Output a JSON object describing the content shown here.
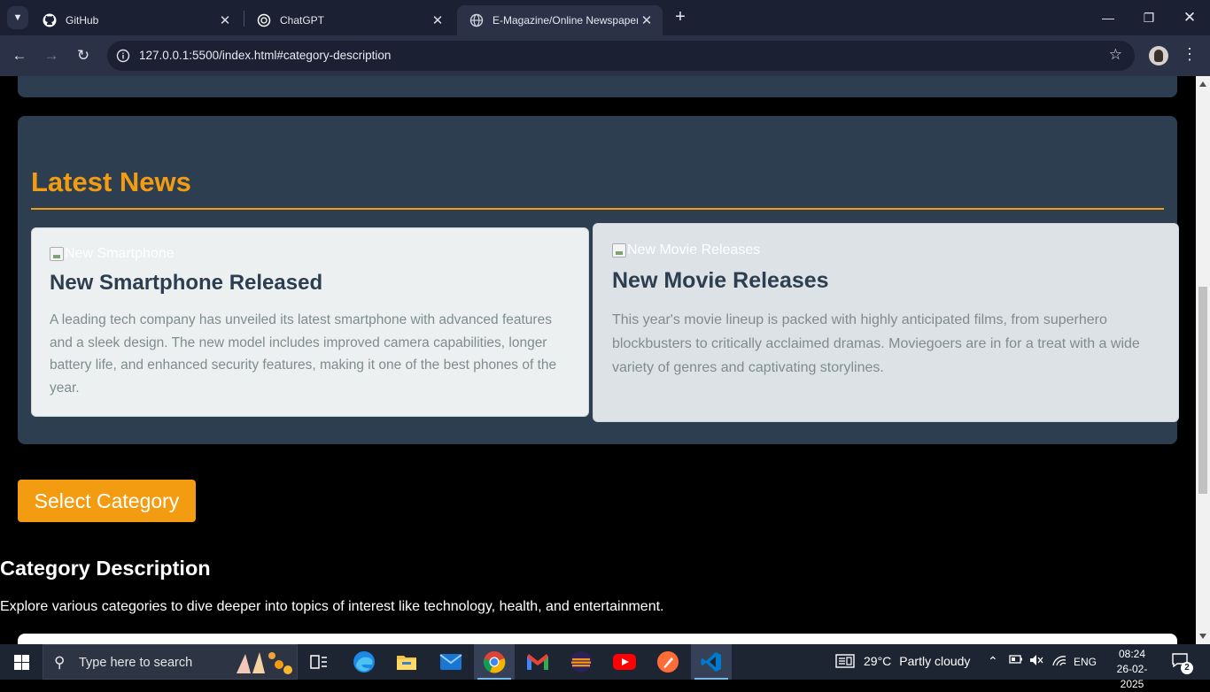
{
  "browser": {
    "tabs": [
      {
        "title": "GitHub",
        "icon": "github-icon"
      },
      {
        "title": "ChatGPT",
        "icon": "chatgpt-icon"
      },
      {
        "title": "E-Magazine/Online Newspaper",
        "icon": "globe-icon",
        "active": true
      }
    ],
    "new_tab_label": "+",
    "url": "127.0.0.1:5500/index.html#category-description"
  },
  "page": {
    "latest_news": {
      "title": "Latest News",
      "articles": [
        {
          "image_alt": "New Smartphone",
          "title": "New Smartphone Released",
          "body": "A leading tech company has unveiled its latest smartphone with advanced features and a sleek design. The new model includes improved camera capabilities, longer battery life, and enhanced security features, making it one of the best phones of the year."
        },
        {
          "image_alt": "New Movie Releases",
          "title": "New Movie Releases",
          "body": "This year's movie lineup is packed with highly anticipated films, from superhero blockbusters to critically acclaimed dramas. Moviegoers are in for a treat with a wide variety of genres and captivating storylines."
        }
      ]
    },
    "select_category_label": "Select Category",
    "category_description": {
      "title": "Category Description",
      "text": "Explore various categories to dive deeper into topics of interest like technology, health, and entertainment."
    }
  },
  "colors": {
    "accent": "#f39c12",
    "section_bg": "#2c3e50",
    "card_bg": "#ecf0f1",
    "card_text": "#7f8c8d",
    "heading": "#2c3e50"
  },
  "taskbar": {
    "search_placeholder": "Type here to search",
    "pinned": [
      "task-view-icon",
      "edge-icon",
      "file-explorer-icon",
      "mail-icon",
      "chrome-icon",
      "gmail-icon",
      "eclipse-icon",
      "youtube-icon",
      "postman-icon",
      "vscode-icon"
    ],
    "weather": {
      "temp": "29°C",
      "condition": "Partly cloudy"
    },
    "language": "ENG",
    "time": "08:24",
    "date": "26-02-2025",
    "notification_count": "2"
  }
}
